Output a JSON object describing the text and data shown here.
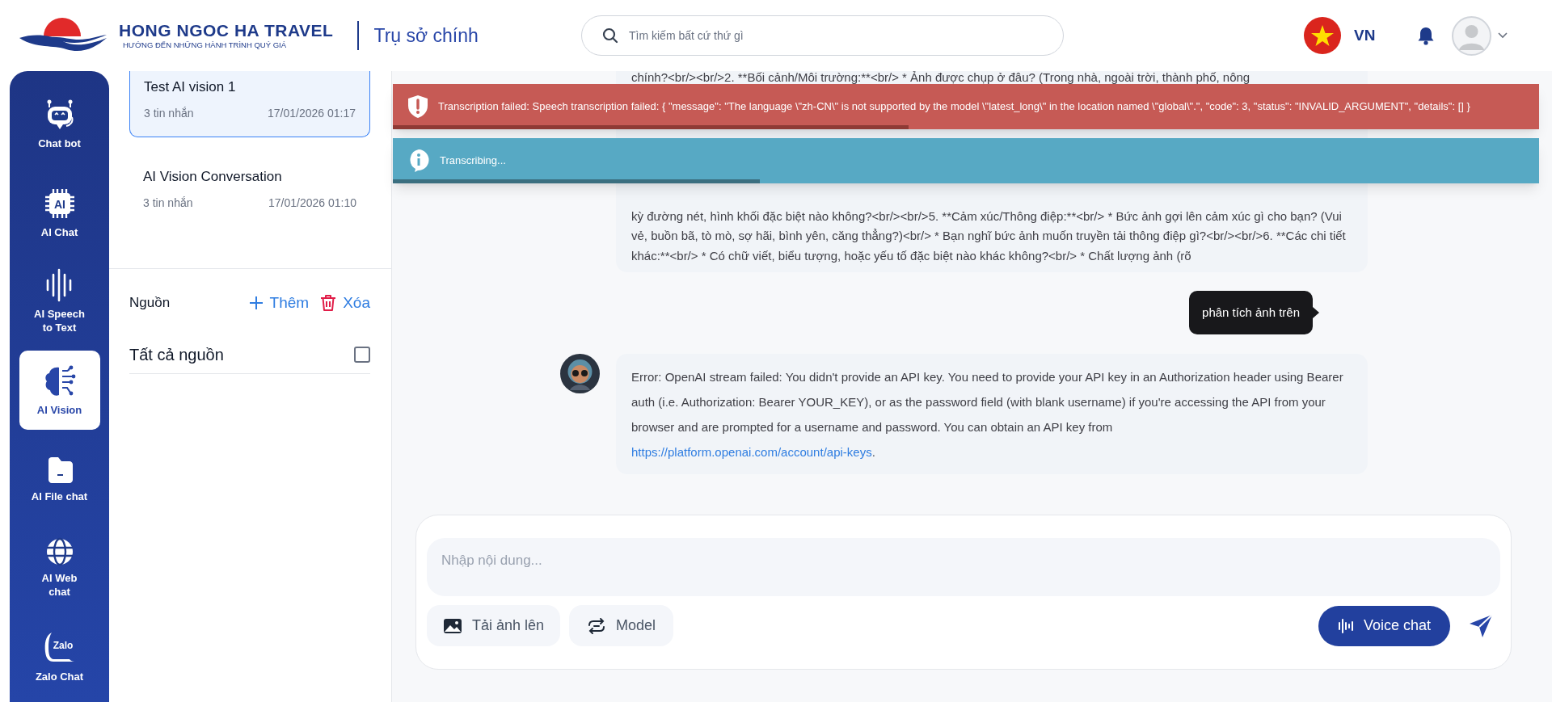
{
  "header": {
    "brand": "HONG NGOC HA TRAVEL",
    "tagline": "HƯỚNG ĐẾN NHỮNG HÀNH TRÌNH QUÝ GIÁ",
    "branch": "Trụ sở chính",
    "search": {
      "placeholder": "Tìm kiếm bất cứ thứ gì"
    },
    "language": "VN"
  },
  "nav": [
    {
      "kind": "robot",
      "label": "Chat bot",
      "selected": false
    },
    {
      "kind": "chip",
      "label": "AI Chat",
      "icon_text": "AI",
      "selected": false
    },
    {
      "kind": "waveform",
      "label": "AI Speech\nto Text",
      "selected": false
    },
    {
      "kind": "brain",
      "label": "AI Vision",
      "selected": true
    },
    {
      "kind": "file",
      "label": "AI File chat",
      "selected": false
    },
    {
      "kind": "globe",
      "label": "AI Web\nchat",
      "selected": false
    },
    {
      "kind": "zalo",
      "label": "Zalo Chat",
      "icon_text": "Zalo",
      "selected": false
    }
  ],
  "conversations": [
    {
      "title": "Test AI vision 1",
      "count": "3 tin nhắn",
      "time": "17/01/2026 01:17",
      "selected": true
    },
    {
      "title": "AI Vision Conversation",
      "count": "3 tin nhắn",
      "time": "17/01/2026 01:10",
      "selected": false
    }
  ],
  "sources": {
    "title": "Nguồn",
    "add": "Thêm",
    "delete": "Xóa",
    "all_label": "Tất cả nguồn",
    "all_checked": false
  },
  "messages": [
    {
      "kind": "assistant",
      "show_avatar": false,
      "top_text": "chính?<br/><br/>2. **Bối cảnh/Môi trường:**<br/> * Ảnh được chụp ở đâu? (Trong nhà, ngoài trời, thành phố, nông",
      "text": "kỳ đường nét, hình khối đặc biệt nào không?<br/><br/>5. **Cảm xúc/Thông điệp:**<br/> * Bức ảnh gợi lên cảm xúc gì cho bạn? (Vui vẻ, buồn bã, tò mò, sợ hãi, bình yên, căng thẳng?)<br/> * Bạn nghĩ bức ảnh muốn truyền tải thông điệp gì?<br/><br/>6. **Các chi tiết khác:**<br/> * Có chữ viết, biểu tượng, hoặc yếu tố đặc biệt nào khác không?<br/> * Chất lượng ảnh (rõ"
    },
    {
      "kind": "user",
      "text": "phân tích ảnh trên"
    },
    {
      "kind": "assistant",
      "show_avatar": true,
      "text": "Error: OpenAI stream failed: You didn't provide an API key. You need to provide your API key in an Authorization header using Bearer auth (i.e. Authorization: Bearer YOUR_KEY), or as the password field (with blank username) if you're accessing the API from your browser and are prompted for a username and password. You can obtain an API key from",
      "link": "https://platform.openai.com/account/api-keys",
      "link_suffix": "."
    }
  ],
  "toasts": [
    {
      "kind": "error",
      "text": "Transcription failed: Speech transcription failed: { \"message\": \"The language \\\"zh-CN\\\" is not supported by the model \\\"latest_long\\\" in the location named \\\"global\\\".\", \"code\": 3, \"status\": \"INVALID_ARGUMENT\", \"details\": [] }",
      "level": 0.45
    },
    {
      "kind": "info",
      "text": "Transcribing...",
      "level": 0.32
    }
  ],
  "composer": {
    "placeholder": "Nhập nội dung...",
    "upload": "Tải ảnh lên",
    "model": "Model",
    "voice": "Voice chat"
  }
}
